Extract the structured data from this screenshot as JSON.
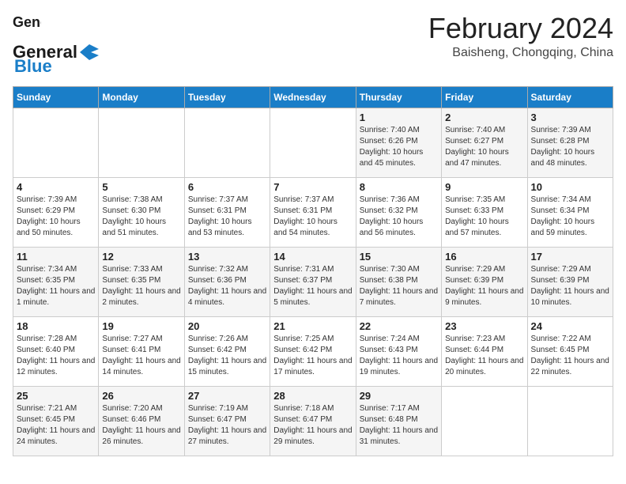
{
  "logo": {
    "line1": "General",
    "line2": "Blue"
  },
  "title": "February 2024",
  "subtitle": "Baisheng, Chongqing, China",
  "days_of_week": [
    "Sunday",
    "Monday",
    "Tuesday",
    "Wednesday",
    "Thursday",
    "Friday",
    "Saturday"
  ],
  "weeks": [
    [
      {
        "day": "",
        "content": ""
      },
      {
        "day": "",
        "content": ""
      },
      {
        "day": "",
        "content": ""
      },
      {
        "day": "",
        "content": ""
      },
      {
        "day": "1",
        "content": "Sunrise: 7:40 AM\nSunset: 6:26 PM\nDaylight: 10 hours\nand 45 minutes."
      },
      {
        "day": "2",
        "content": "Sunrise: 7:40 AM\nSunset: 6:27 PM\nDaylight: 10 hours\nand 47 minutes."
      },
      {
        "day": "3",
        "content": "Sunrise: 7:39 AM\nSunset: 6:28 PM\nDaylight: 10 hours\nand 48 minutes."
      }
    ],
    [
      {
        "day": "4",
        "content": "Sunrise: 7:39 AM\nSunset: 6:29 PM\nDaylight: 10 hours\nand 50 minutes."
      },
      {
        "day": "5",
        "content": "Sunrise: 7:38 AM\nSunset: 6:30 PM\nDaylight: 10 hours\nand 51 minutes."
      },
      {
        "day": "6",
        "content": "Sunrise: 7:37 AM\nSunset: 6:31 PM\nDaylight: 10 hours\nand 53 minutes."
      },
      {
        "day": "7",
        "content": "Sunrise: 7:37 AM\nSunset: 6:31 PM\nDaylight: 10 hours\nand 54 minutes."
      },
      {
        "day": "8",
        "content": "Sunrise: 7:36 AM\nSunset: 6:32 PM\nDaylight: 10 hours\nand 56 minutes."
      },
      {
        "day": "9",
        "content": "Sunrise: 7:35 AM\nSunset: 6:33 PM\nDaylight: 10 hours\nand 57 minutes."
      },
      {
        "day": "10",
        "content": "Sunrise: 7:34 AM\nSunset: 6:34 PM\nDaylight: 10 hours\nand 59 minutes."
      }
    ],
    [
      {
        "day": "11",
        "content": "Sunrise: 7:34 AM\nSunset: 6:35 PM\nDaylight: 11 hours\nand 1 minute."
      },
      {
        "day": "12",
        "content": "Sunrise: 7:33 AM\nSunset: 6:35 PM\nDaylight: 11 hours\nand 2 minutes."
      },
      {
        "day": "13",
        "content": "Sunrise: 7:32 AM\nSunset: 6:36 PM\nDaylight: 11 hours\nand 4 minutes."
      },
      {
        "day": "14",
        "content": "Sunrise: 7:31 AM\nSunset: 6:37 PM\nDaylight: 11 hours\nand 5 minutes."
      },
      {
        "day": "15",
        "content": "Sunrise: 7:30 AM\nSunset: 6:38 PM\nDaylight: 11 hours\nand 7 minutes."
      },
      {
        "day": "16",
        "content": "Sunrise: 7:29 AM\nSunset: 6:39 PM\nDaylight: 11 hours\nand 9 minutes."
      },
      {
        "day": "17",
        "content": "Sunrise: 7:29 AM\nSunset: 6:39 PM\nDaylight: 11 hours\nand 10 minutes."
      }
    ],
    [
      {
        "day": "18",
        "content": "Sunrise: 7:28 AM\nSunset: 6:40 PM\nDaylight: 11 hours\nand 12 minutes."
      },
      {
        "day": "19",
        "content": "Sunrise: 7:27 AM\nSunset: 6:41 PM\nDaylight: 11 hours\nand 14 minutes."
      },
      {
        "day": "20",
        "content": "Sunrise: 7:26 AM\nSunset: 6:42 PM\nDaylight: 11 hours\nand 15 minutes."
      },
      {
        "day": "21",
        "content": "Sunrise: 7:25 AM\nSunset: 6:42 PM\nDaylight: 11 hours\nand 17 minutes."
      },
      {
        "day": "22",
        "content": "Sunrise: 7:24 AM\nSunset: 6:43 PM\nDaylight: 11 hours\nand 19 minutes."
      },
      {
        "day": "23",
        "content": "Sunrise: 7:23 AM\nSunset: 6:44 PM\nDaylight: 11 hours\nand 20 minutes."
      },
      {
        "day": "24",
        "content": "Sunrise: 7:22 AM\nSunset: 6:45 PM\nDaylight: 11 hours\nand 22 minutes."
      }
    ],
    [
      {
        "day": "25",
        "content": "Sunrise: 7:21 AM\nSunset: 6:45 PM\nDaylight: 11 hours\nand 24 minutes."
      },
      {
        "day": "26",
        "content": "Sunrise: 7:20 AM\nSunset: 6:46 PM\nDaylight: 11 hours\nand 26 minutes."
      },
      {
        "day": "27",
        "content": "Sunrise: 7:19 AM\nSunset: 6:47 PM\nDaylight: 11 hours\nand 27 minutes."
      },
      {
        "day": "28",
        "content": "Sunrise: 7:18 AM\nSunset: 6:47 PM\nDaylight: 11 hours\nand 29 minutes."
      },
      {
        "day": "29",
        "content": "Sunrise: 7:17 AM\nSunset: 6:48 PM\nDaylight: 11 hours\nand 31 minutes."
      },
      {
        "day": "",
        "content": ""
      },
      {
        "day": "",
        "content": ""
      }
    ]
  ]
}
